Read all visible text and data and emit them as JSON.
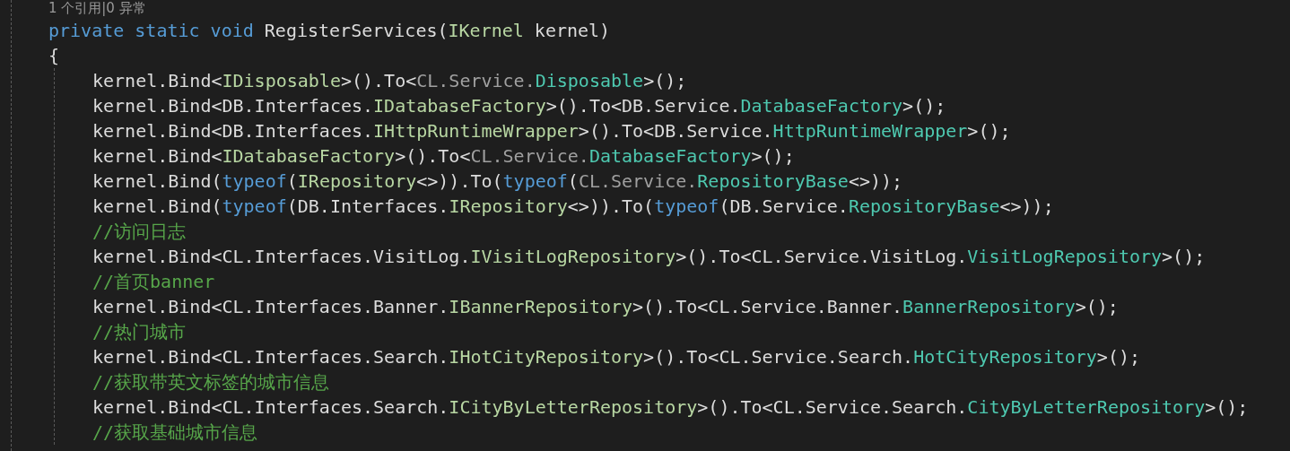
{
  "codelens": "1 个引用|0 异常",
  "lines": [
    {
      "tokens": [
        {
          "kind": "keyword",
          "t": "private static void "
        },
        {
          "kind": "plain",
          "t": "RegisterServices("
        },
        {
          "kind": "interface",
          "t": "IKernel"
        },
        {
          "kind": "plain",
          "t": " kernel)"
        }
      ]
    },
    {
      "tokens": [
        {
          "kind": "plain",
          "t": "{"
        }
      ],
      "children": [
        {
          "tokens": [
            {
              "kind": "plain",
              "t": "kernel.Bind<"
            },
            {
              "kind": "interface",
              "t": "IDisposable"
            },
            {
              "kind": "plain",
              "t": ">().To<"
            },
            {
              "kind": "namespace",
              "t": "CL.Service."
            },
            {
              "kind": "class",
              "t": "Disposable"
            },
            {
              "kind": "plain",
              "t": ">();"
            }
          ]
        },
        {
          "tokens": [
            {
              "kind": "plain",
              "t": "kernel.Bind<DB.Interfaces."
            },
            {
              "kind": "interface",
              "t": "IDatabaseFactory"
            },
            {
              "kind": "plain",
              "t": ">().To<DB.Service."
            },
            {
              "kind": "class",
              "t": "DatabaseFactory"
            },
            {
              "kind": "plain",
              "t": ">();"
            }
          ]
        },
        {
          "tokens": [
            {
              "kind": "plain",
              "t": "kernel.Bind<DB.Interfaces."
            },
            {
              "kind": "interface",
              "t": "IHttpRuntimeWrapper"
            },
            {
              "kind": "plain",
              "t": ">().To<DB.Service."
            },
            {
              "kind": "class",
              "t": "HttpRuntimeWrapper"
            },
            {
              "kind": "plain",
              "t": ">();"
            }
          ]
        },
        {
          "tokens": [
            {
              "kind": "plain",
              "t": "kernel.Bind<"
            },
            {
              "kind": "interface",
              "t": "IDatabaseFactory"
            },
            {
              "kind": "plain",
              "t": ">().To<"
            },
            {
              "kind": "namespace",
              "t": "CL.Service."
            },
            {
              "kind": "class",
              "t": "DatabaseFactory"
            },
            {
              "kind": "plain",
              "t": ">();"
            }
          ]
        },
        {
          "tokens": [
            {
              "kind": "plain",
              "t": "kernel.Bind("
            },
            {
              "kind": "keyword",
              "t": "typeof"
            },
            {
              "kind": "plain",
              "t": "("
            },
            {
              "kind": "interface",
              "t": "IRepository"
            },
            {
              "kind": "plain",
              "t": "<>)).To("
            },
            {
              "kind": "keyword",
              "t": "typeof"
            },
            {
              "kind": "plain",
              "t": "("
            },
            {
              "kind": "namespace",
              "t": "CL.Service."
            },
            {
              "kind": "class",
              "t": "RepositoryBase"
            },
            {
              "kind": "plain",
              "t": "<>));"
            }
          ]
        },
        {
          "tokens": [
            {
              "kind": "plain",
              "t": "kernel.Bind("
            },
            {
              "kind": "keyword",
              "t": "typeof"
            },
            {
              "kind": "plain",
              "t": "(DB.Interfaces."
            },
            {
              "kind": "interface",
              "t": "IRepository"
            },
            {
              "kind": "plain",
              "t": "<>)).To("
            },
            {
              "kind": "keyword",
              "t": "typeof"
            },
            {
              "kind": "plain",
              "t": "(DB.Service."
            },
            {
              "kind": "class",
              "t": "RepositoryBase"
            },
            {
              "kind": "plain",
              "t": "<>));"
            }
          ]
        },
        {
          "tokens": [
            {
              "kind": "comment",
              "t": "//访问日志"
            }
          ]
        },
        {
          "tokens": [
            {
              "kind": "plain",
              "t": "kernel.Bind<CL.Interfaces.VisitLog."
            },
            {
              "kind": "interface",
              "t": "IVisitLogRepository"
            },
            {
              "kind": "plain",
              "t": ">().To<CL.Service.VisitLog."
            },
            {
              "kind": "class",
              "t": "VisitLogRepository"
            },
            {
              "kind": "plain",
              "t": ">();"
            }
          ]
        },
        {
          "tokens": [
            {
              "kind": "comment",
              "t": "//首页banner"
            }
          ]
        },
        {
          "tokens": [
            {
              "kind": "plain",
              "t": "kernel.Bind<CL.Interfaces.Banner."
            },
            {
              "kind": "interface",
              "t": "IBannerRepository"
            },
            {
              "kind": "plain",
              "t": ">().To<CL.Service.Banner."
            },
            {
              "kind": "class",
              "t": "BannerRepository"
            },
            {
              "kind": "plain",
              "t": ">();"
            }
          ]
        },
        {
          "tokens": [
            {
              "kind": "comment",
              "t": "//热门城市"
            }
          ]
        },
        {
          "tokens": [
            {
              "kind": "plain",
              "t": "kernel.Bind<CL.Interfaces.Search."
            },
            {
              "kind": "interface",
              "t": "IHotCityRepository"
            },
            {
              "kind": "plain",
              "t": ">().To<CL.Service.Search."
            },
            {
              "kind": "class",
              "t": "HotCityRepository"
            },
            {
              "kind": "plain",
              "t": ">();"
            }
          ]
        },
        {
          "tokens": [
            {
              "kind": "comment",
              "t": "//获取带英文标签的城市信息"
            }
          ]
        },
        {
          "tokens": [
            {
              "kind": "plain",
              "t": "kernel.Bind<CL.Interfaces.Search."
            },
            {
              "kind": "interface",
              "t": "ICityByLetterRepository"
            },
            {
              "kind": "plain",
              "t": ">().To<CL.Service.Search."
            },
            {
              "kind": "class",
              "t": "CityByLetterRepository"
            },
            {
              "kind": "plain",
              "t": ">();"
            }
          ]
        },
        {
          "tokens": [
            {
              "kind": "comment",
              "t": "//获取基础城市信息"
            }
          ]
        }
      ]
    }
  ]
}
